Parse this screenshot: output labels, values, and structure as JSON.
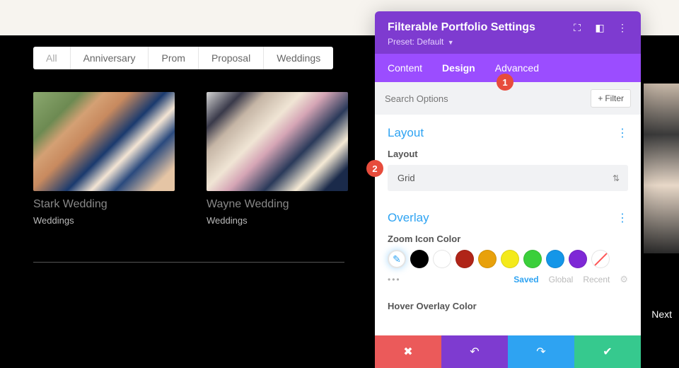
{
  "filters": [
    "All",
    "Anniversary",
    "Prom",
    "Proposal",
    "Weddings"
  ],
  "cards": [
    {
      "title": "Stark Wedding",
      "cat": "Weddings"
    },
    {
      "title": "Wayne Wedding",
      "cat": "Weddings"
    }
  ],
  "next_label": "Next",
  "panel": {
    "title": "Filterable Portfolio Settings",
    "preset_label": "Preset: Default",
    "tabs": {
      "content": "Content",
      "design": "Design",
      "advanced": "Advanced"
    },
    "search_placeholder": "Search Options",
    "filter_btn": "Filter",
    "sections": {
      "layout_title": "Layout",
      "layout_field": "Layout",
      "layout_value": "Grid",
      "overlay_title": "Overlay",
      "zoom_label": "Zoom Icon Color",
      "hover_label": "Hover Overlay Color"
    },
    "swatch_colors": [
      "#000000",
      "#ffffff",
      "#b02418",
      "#e8a10b",
      "#f4ea1a",
      "#3bcf3b",
      "#1496e8",
      "#7e28d6"
    ],
    "meta": {
      "saved": "Saved",
      "global": "Global",
      "recent": "Recent"
    }
  },
  "callouts": {
    "one": "1",
    "two": "2"
  }
}
